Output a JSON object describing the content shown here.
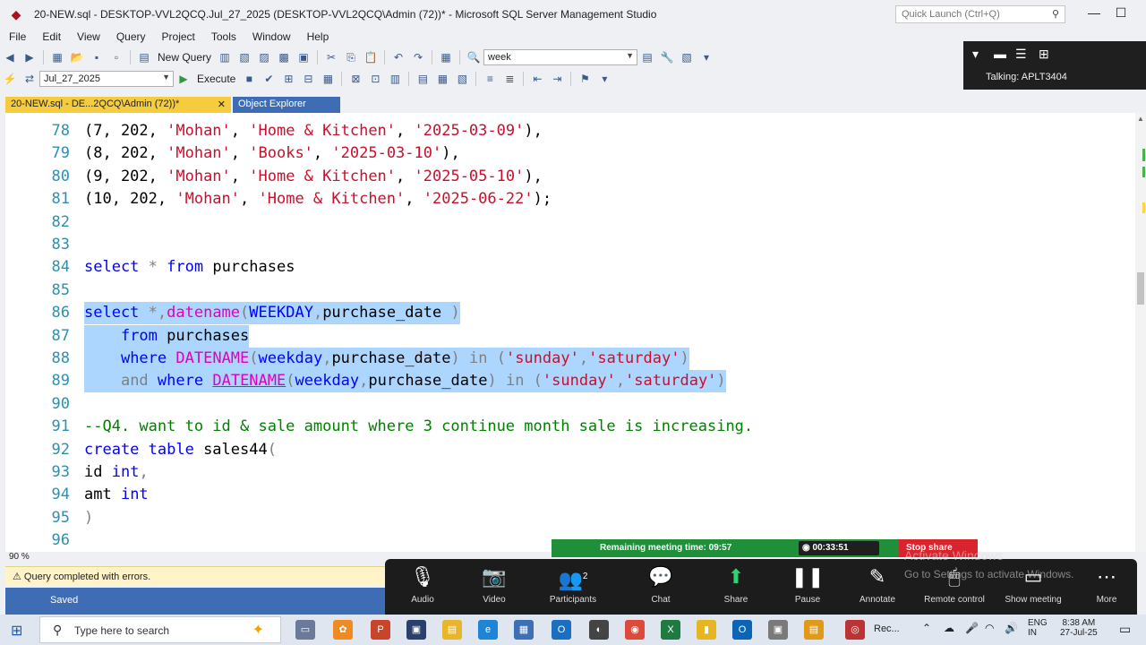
{
  "window": {
    "title": "20-NEW.sql - DESKTOP-VVL2QCQ.Jul_27_2025 (DESKTOP-VVL2QCQ\\Admin (72))* - Microsoft SQL Server Management Studio",
    "quick_launch_placeholder": "Quick Launch (Ctrl+Q)"
  },
  "menu": [
    "File",
    "Edit",
    "View",
    "Query",
    "Project",
    "Tools",
    "Window",
    "Help"
  ],
  "toolbar": {
    "new_query_label": "New Query",
    "search_value": "week",
    "database_value": "Jul_27_2025",
    "execute_label": "Execute"
  },
  "zoom_panel": {
    "talking_label": "Talking: APLT3404"
  },
  "tabs": {
    "active_label": "20-NEW.sql - DE...2QCQ\\Admin (72))*",
    "inactive_label": "Object Explorer"
  },
  "editor": {
    "lines": [
      {
        "n": "78",
        "segments": [
          [
            "bl",
            "(7, 202, "
          ],
          [
            "str",
            "'Mohan'"
          ],
          [
            "bl",
            ", "
          ],
          [
            "str",
            "'Home & Kitchen'"
          ],
          [
            "bl",
            ", "
          ],
          [
            "str",
            "'2025-03-09'"
          ],
          [
            "bl",
            "),"
          ]
        ]
      },
      {
        "n": "79",
        "segments": [
          [
            "bl",
            "(8, 202, "
          ],
          [
            "str",
            "'Mohan'"
          ],
          [
            "bl",
            ", "
          ],
          [
            "str",
            "'Books'"
          ],
          [
            "bl",
            ", "
          ],
          [
            "str",
            "'2025-03-10'"
          ],
          [
            "bl",
            "),"
          ]
        ]
      },
      {
        "n": "80",
        "segments": [
          [
            "bl",
            "(9, 202, "
          ],
          [
            "str",
            "'Mohan'"
          ],
          [
            "bl",
            ", "
          ],
          [
            "str",
            "'Home & Kitchen'"
          ],
          [
            "bl",
            ", "
          ],
          [
            "str",
            "'2025-05-10'"
          ],
          [
            "bl",
            "),"
          ]
        ]
      },
      {
        "n": "81",
        "segments": [
          [
            "bl",
            "(10, 202, "
          ],
          [
            "str",
            "'Mohan'"
          ],
          [
            "bl",
            ", "
          ],
          [
            "str",
            "'Home & Kitchen'"
          ],
          [
            "bl",
            ", "
          ],
          [
            "str",
            "'2025-06-22'"
          ],
          [
            "bl",
            ");"
          ]
        ]
      },
      {
        "n": "82",
        "segments": []
      },
      {
        "n": "83",
        "segments": []
      },
      {
        "n": "84",
        "segments": [
          [
            "kw",
            "select"
          ],
          [
            "gry",
            " * "
          ],
          [
            "kw",
            "from"
          ],
          [
            "bl",
            " purchases"
          ]
        ]
      },
      {
        "n": "85",
        "segments": []
      },
      {
        "n": "86",
        "sel": true,
        "segments": [
          [
            "kw",
            "select"
          ],
          [
            "gry",
            " *,"
          ],
          [
            "fn",
            "datename"
          ],
          [
            "gry",
            "("
          ],
          [
            "kw",
            "WEEKDAY"
          ],
          [
            "gry",
            ","
          ],
          [
            "bl",
            "purchase_date "
          ],
          [
            "gry",
            ")"
          ]
        ]
      },
      {
        "n": "87",
        "sel": true,
        "segments": [
          [
            "bl",
            "    "
          ],
          [
            "kw",
            "from"
          ],
          [
            "bl",
            " purchases"
          ]
        ]
      },
      {
        "n": "88",
        "sel": true,
        "segments": [
          [
            "bl",
            "    "
          ],
          [
            "kw",
            "where"
          ],
          [
            "bl",
            " "
          ],
          [
            "fn",
            "DATENAME"
          ],
          [
            "gry",
            "("
          ],
          [
            "kw",
            "weekday"
          ],
          [
            "gry",
            ","
          ],
          [
            "bl",
            "purchase_date"
          ],
          [
            "gry",
            ") "
          ],
          [
            "gry",
            "in"
          ],
          [
            "gry",
            " ("
          ],
          [
            "str",
            "'sunday'"
          ],
          [
            "gry",
            ","
          ],
          [
            "str",
            "'saturday'"
          ],
          [
            "gry",
            ")"
          ]
        ]
      },
      {
        "n": "89",
        "sel": true,
        "segments": [
          [
            "bl",
            "    "
          ],
          [
            "gry",
            "and"
          ],
          [
            "bl",
            " "
          ],
          [
            "kw",
            "where"
          ],
          [
            "bl",
            " "
          ],
          [
            "linkfn",
            "DATENAME"
          ],
          [
            "gry",
            "("
          ],
          [
            "kw",
            "weekday"
          ],
          [
            "gry",
            ","
          ],
          [
            "bl",
            "purchase_date"
          ],
          [
            "gry",
            ") "
          ],
          [
            "gry",
            "in"
          ],
          [
            "gry",
            " ("
          ],
          [
            "str",
            "'sunday'"
          ],
          [
            "gry",
            ","
          ],
          [
            "str",
            "'saturday'"
          ],
          [
            "gry",
            ")"
          ]
        ]
      },
      {
        "n": "90",
        "segments": []
      },
      {
        "n": "91",
        "segments": [
          [
            "cmt",
            "--Q4. want to id & sale amount where 3 continue month sale is increasing."
          ]
        ]
      },
      {
        "n": "92",
        "segments": [
          [
            "kw",
            "create table"
          ],
          [
            "bl",
            " sales44"
          ],
          [
            "gry",
            "("
          ]
        ]
      },
      {
        "n": "93",
        "segments": [
          [
            "bl",
            "id "
          ],
          [
            "kw",
            "int"
          ],
          [
            "gry",
            ","
          ]
        ]
      },
      {
        "n": "94",
        "segments": [
          [
            "bl",
            "amt "
          ],
          [
            "kw",
            "int"
          ]
        ]
      },
      {
        "n": "95",
        "segments": [
          [
            "gry",
            ")"
          ]
        ]
      },
      {
        "n": "96",
        "segments": []
      }
    ]
  },
  "status": {
    "zoom_level": "90 %",
    "message": "Query completed with errors.",
    "saved": "Saved"
  },
  "meeting": {
    "remaining": "Remaining meeting time: 09:57",
    "timer": "00:33:51",
    "stop_share": "Stop share",
    "participants_count": "2",
    "controls": [
      "Audio",
      "Video",
      "Participants",
      "Chat",
      "Share",
      "Pause",
      "Annotate",
      "Remote control",
      "Show meeting",
      "More"
    ],
    "watermark_title": "Activate Windows",
    "watermark_sub": "Go to Settings to activate Windows."
  },
  "taskbar": {
    "search_placeholder": "Type here to search",
    "language": "ENG",
    "language_sub": "IN",
    "time": "8:38 AM",
    "date": "27-Jul-25",
    "rec_label": "Rec..."
  }
}
